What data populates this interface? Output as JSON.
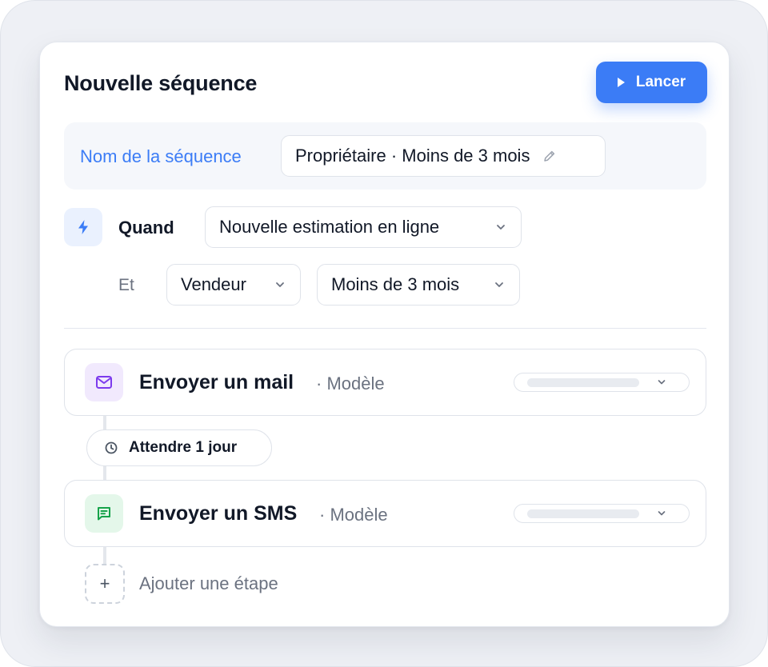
{
  "header": {
    "title": "Nouvelle séquence",
    "launch_label": "Lancer"
  },
  "sequence_name": {
    "label": "Nom de la séquence",
    "value": "Propriétaire · Moins de 3 mois"
  },
  "trigger": {
    "when_label": "Quand",
    "when_value": "Nouvelle estimation en ligne",
    "and_label": "Et",
    "condition_1": "Vendeur",
    "condition_2": "Moins de 3 mois"
  },
  "steps": [
    {
      "title": "Envoyer un mail",
      "subtitle": "· Modèle",
      "icon": "mail-icon",
      "icon_color": "#7c3aed",
      "icon_bg": "#f1e9fd"
    },
    {
      "title": "Envoyer un SMS",
      "subtitle": "· Modèle",
      "icon": "message-icon",
      "icon_color": "#16a34a",
      "icon_bg": "#e4f7ea"
    }
  ],
  "wait": {
    "label": "Attendre 1 jour",
    "icon": "clock-icon"
  },
  "add_step": {
    "symbol": "+",
    "label": "Ajouter une étape"
  },
  "colors": {
    "accent": "#3b7cf6",
    "text": "#111827",
    "muted": "#6b7280",
    "border": "#dfe3ea"
  }
}
